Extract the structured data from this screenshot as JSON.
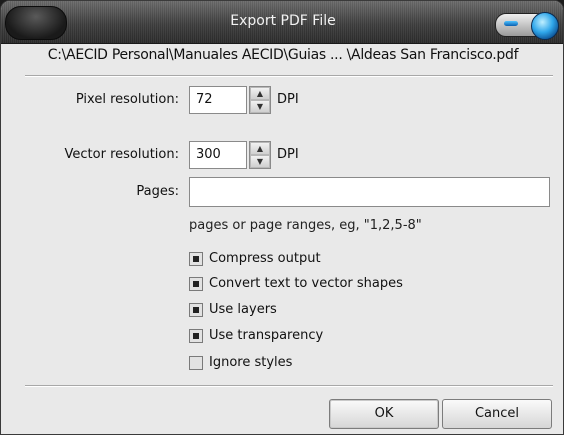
{
  "window": {
    "title": "Export PDF File",
    "path": "C:\\AECID Personal\\Manuales AECID\\Guias ... \\Aldeas San Francisco.pdf"
  },
  "form": {
    "pixel_resolution": {
      "label": "Pixel resolution:",
      "value": "72",
      "unit": "DPI"
    },
    "vector_resolution": {
      "label": "Vector resolution:",
      "value": "300",
      "unit": "DPI"
    },
    "pages": {
      "label": "Pages:",
      "value": "",
      "hint": "pages or page ranges, eg, \"1,2,5-8\""
    }
  },
  "options": [
    {
      "label": "Compress output",
      "checked": true
    },
    {
      "label": "Convert text to vector shapes",
      "checked": true
    },
    {
      "label": "Use layers",
      "checked": true
    },
    {
      "label": "Use transparency",
      "checked": true
    },
    {
      "label": "Ignore styles",
      "checked": false
    }
  ],
  "buttons": {
    "ok": "OK",
    "cancel": "Cancel"
  }
}
